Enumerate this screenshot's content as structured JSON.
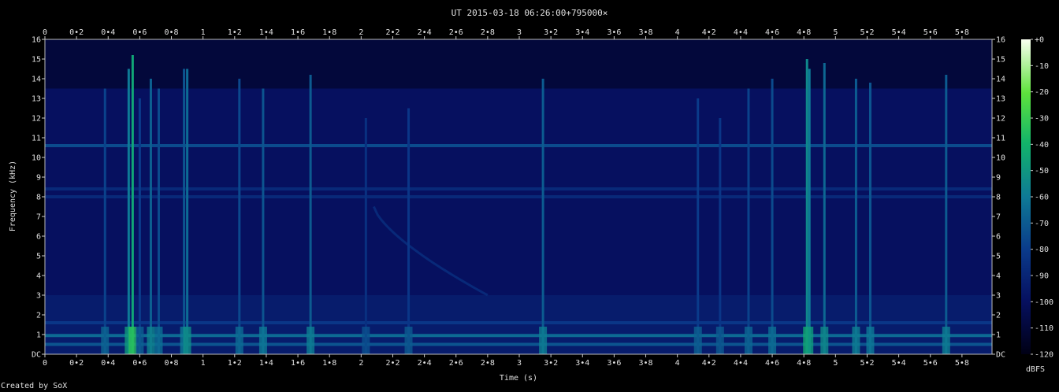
{
  "chart_data": {
    "type": "heatmap",
    "title": "UT 2015-03-18 06:26:00+795000×",
    "xlabel": "Time (s)",
    "ylabel": "Frequency (kHz)",
    "xlim": [
      0,
      5.99
    ],
    "ylim": [
      0,
      16
    ],
    "x_ticks": [
      "0",
      "0•2",
      "0•4",
      "0•6",
      "0•8",
      "1",
      "1•2",
      "1•4",
      "1•6",
      "1•8",
      "2",
      "2•2",
      "2•4",
      "2•6",
      "2•8",
      "3",
      "3•2",
      "3•4",
      "3•6",
      "3•8",
      "4",
      "4•2",
      "4•4",
      "4•6",
      "4•8",
      "5",
      "5•2",
      "5•4",
      "5•6",
      "5•8"
    ],
    "y_ticks": [
      "DC",
      "1",
      "2",
      "3",
      "4",
      "5",
      "6",
      "7",
      "8",
      "9",
      "10",
      "11",
      "12",
      "13",
      "14",
      "15",
      "16"
    ],
    "colorbar": {
      "label": "dBFS",
      "ticks": [
        "+0",
        "-10",
        "-20",
        "-30",
        "-40",
        "-50",
        "-60",
        "-70",
        "-80",
        "-90",
        "-100",
        "-110",
        "-120"
      ],
      "range_db": [
        -120,
        0
      ]
    },
    "features": {
      "background_level_db": -100,
      "steady_tones": [
        {
          "freq_khz": 10.6,
          "level_db": -75
        },
        {
          "freq_khz": 8.4,
          "level_db": -88
        },
        {
          "freq_khz": 8.0,
          "level_db": -88
        },
        {
          "freq_khz": 1.6,
          "level_db": -82
        },
        {
          "freq_khz": 0.95,
          "level_db": -65
        },
        {
          "freq_khz": 0.5,
          "level_db": -72
        }
      ],
      "impulses": [
        {
          "t": 0.38,
          "top_khz": 13.5,
          "db": -78
        },
        {
          "t": 0.53,
          "top_khz": 14.5,
          "db": -60
        },
        {
          "t": 0.555,
          "top_khz": 15.2,
          "db": -45
        },
        {
          "t": 0.6,
          "top_khz": 13.0,
          "db": -80
        },
        {
          "t": 0.67,
          "top_khz": 14.0,
          "db": -68
        },
        {
          "t": 0.72,
          "top_khz": 13.5,
          "db": -75
        },
        {
          "t": 0.88,
          "top_khz": 14.5,
          "db": -72
        },
        {
          "t": 0.9,
          "top_khz": 14.5,
          "db": -65
        },
        {
          "t": 1.23,
          "top_khz": 14.0,
          "db": -76
        },
        {
          "t": 1.38,
          "top_khz": 13.5,
          "db": -72
        },
        {
          "t": 1.68,
          "top_khz": 14.2,
          "db": -70
        },
        {
          "t": 2.03,
          "top_khz": 12.0,
          "db": -85
        },
        {
          "t": 2.3,
          "top_khz": 12.5,
          "db": -82
        },
        {
          "t": 3.15,
          "top_khz": 14.0,
          "db": -70
        },
        {
          "t": 4.13,
          "top_khz": 13.0,
          "db": -80
        },
        {
          "t": 4.27,
          "top_khz": 12.0,
          "db": -82
        },
        {
          "t": 4.45,
          "top_khz": 13.5,
          "db": -78
        },
        {
          "t": 4.6,
          "top_khz": 14.0,
          "db": -75
        },
        {
          "t": 4.82,
          "top_khz": 15.0,
          "db": -55
        },
        {
          "t": 4.835,
          "top_khz": 14.5,
          "db": -60
        },
        {
          "t": 4.93,
          "top_khz": 14.8,
          "db": -66
        },
        {
          "t": 5.13,
          "top_khz": 14.0,
          "db": -70
        },
        {
          "t": 5.22,
          "top_khz": 13.8,
          "db": -72
        },
        {
          "t": 5.7,
          "top_khz": 14.2,
          "db": -70
        }
      ],
      "whistler": {
        "t_start": 2.08,
        "t_end": 2.8,
        "f_start_khz": 7.5,
        "f_end_khz": 3.0,
        "db": -88
      }
    }
  },
  "credit": "Created by SoX"
}
